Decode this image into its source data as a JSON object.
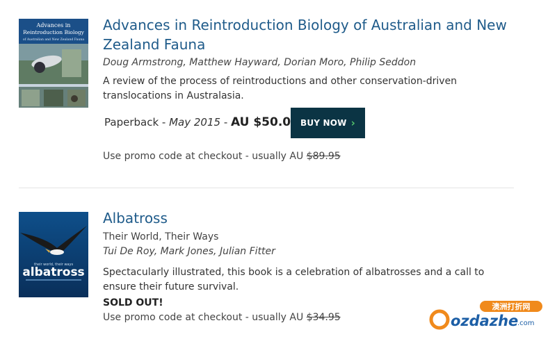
{
  "books": [
    {
      "title": "Advances in Reintroduction Biology of Australian and New Zealand Fauna",
      "authors": "Doug Armstrong, Matthew Hayward, Dorian Moro, Philip Seddon",
      "description": "A review of the process of reintroductions and other conservation-driven translocations in Australasia.",
      "format": "Paperback",
      "date": "May 2015",
      "price": "AU $50.00",
      "buy_label": "BUY NOW",
      "promo_text": "Use promo code at checkout - usually AU",
      "usual_price": "$89.95",
      "cover": {
        "line1": "Advances in",
        "line2": "Reintroduction Biology",
        "line3": "of Australian and New Zealand Fauna"
      }
    },
    {
      "title": "Albatross",
      "subtitle": "Their World, Their Ways",
      "authors": "Tui De Roy, Mark Jones, Julian Fitter",
      "description": "Spectacularly illustrated, this book is a celebration of albatrosses and a call to ensure their future survival.",
      "status": "SOLD OUT!",
      "promo_text": "Use promo code at checkout - usually AU",
      "usual_price": "$34.95",
      "cover": {
        "tagline": "their world, their ways",
        "title": "albatross"
      }
    }
  ],
  "watermark": {
    "top_text": "澳洲打折网",
    "brand": "ozdazhe",
    "suffix": ".com"
  },
  "colors": {
    "title_link": "#1f5b8a",
    "buy_button": "#0b3444",
    "buy_chevron": "#54c46b"
  }
}
